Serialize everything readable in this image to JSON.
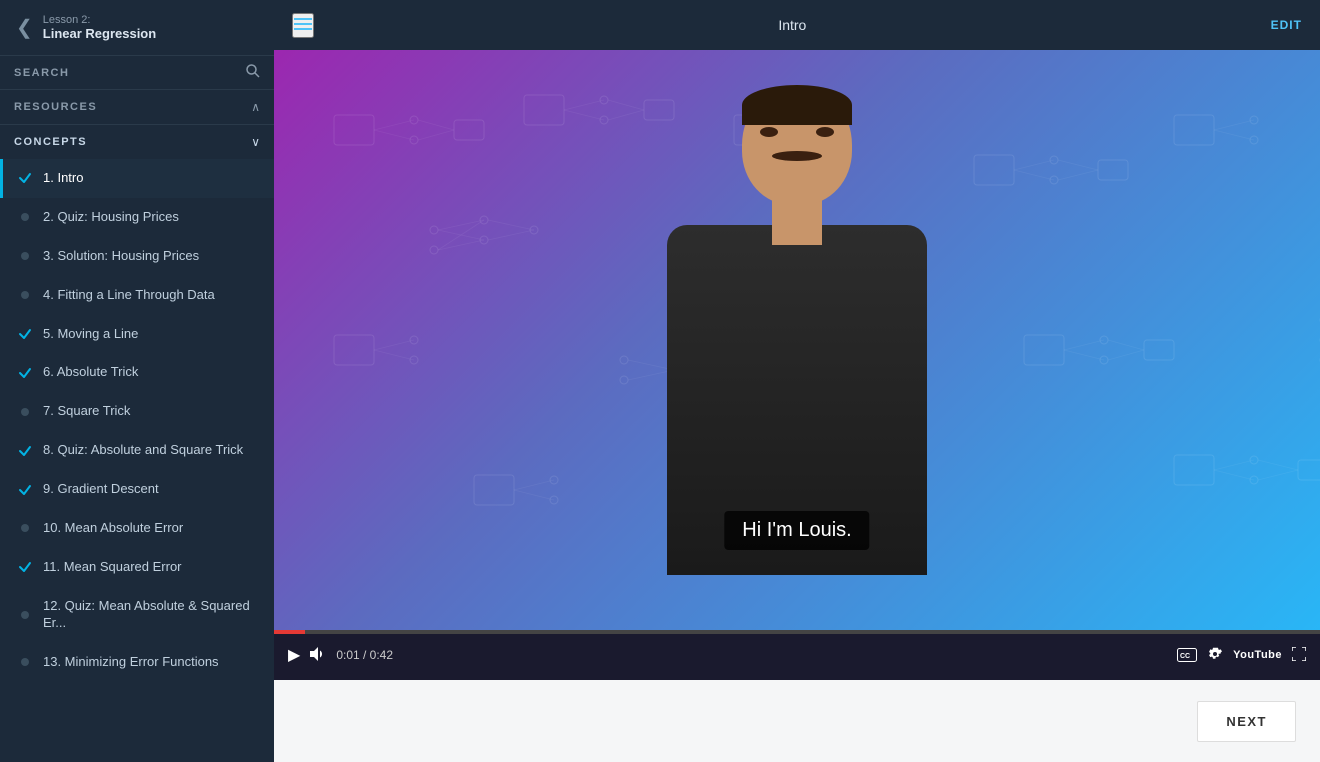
{
  "sidebar": {
    "lesson_num": "Lesson 2:",
    "lesson_title": "Linear Regression",
    "search_label": "SEARCH",
    "resources_label": "RESOURCES",
    "concepts_label": "CONCEPTS",
    "items": [
      {
        "id": 1,
        "label": "1. Intro",
        "status": "active",
        "checked": true
      },
      {
        "id": 2,
        "label": "2. Quiz: Housing Prices",
        "status": "normal",
        "checked": false
      },
      {
        "id": 3,
        "label": "3. Solution: Housing Prices",
        "status": "normal",
        "checked": false
      },
      {
        "id": 4,
        "label": "4. Fitting a Line Through Data",
        "status": "normal",
        "checked": false
      },
      {
        "id": 5,
        "label": "5. Moving a Line",
        "status": "normal",
        "checked": true
      },
      {
        "id": 6,
        "label": "6. Absolute Trick",
        "status": "normal",
        "checked": true
      },
      {
        "id": 7,
        "label": "7. Square Trick",
        "status": "normal",
        "checked": false
      },
      {
        "id": 8,
        "label": "8. Quiz: Absolute and Square Trick",
        "status": "normal",
        "checked": true
      },
      {
        "id": 9,
        "label": "9. Gradient Descent",
        "status": "normal",
        "checked": true
      },
      {
        "id": 10,
        "label": "10. Mean Absolute Error",
        "status": "normal",
        "checked": false
      },
      {
        "id": 11,
        "label": "11. Mean Squared Error",
        "status": "normal",
        "checked": true
      },
      {
        "id": 12,
        "label": "12. Quiz: Mean Absolute & Squared Er...",
        "status": "normal",
        "checked": false
      },
      {
        "id": 13,
        "label": "13. Minimizing Error Functions",
        "status": "normal",
        "checked": false
      }
    ]
  },
  "topbar": {
    "title": "Intro",
    "edit_label": "EDIT"
  },
  "video": {
    "subtitle": "Hi I'm Louis.",
    "time_current": "0:01",
    "time_total": "0:42",
    "time_display": "0:01 / 0:42",
    "progress_percent": 3
  },
  "footer": {
    "next_label": "NEXT"
  },
  "icons": {
    "back": "❮",
    "menu": "☰",
    "search": "🔍",
    "chevron_up": "∧",
    "chevron_down": "∨",
    "play": "▶",
    "volume": "🔊",
    "cc": "CC",
    "settings": "⚙",
    "youtube": "YouTube",
    "fullscreen": "⛶"
  }
}
